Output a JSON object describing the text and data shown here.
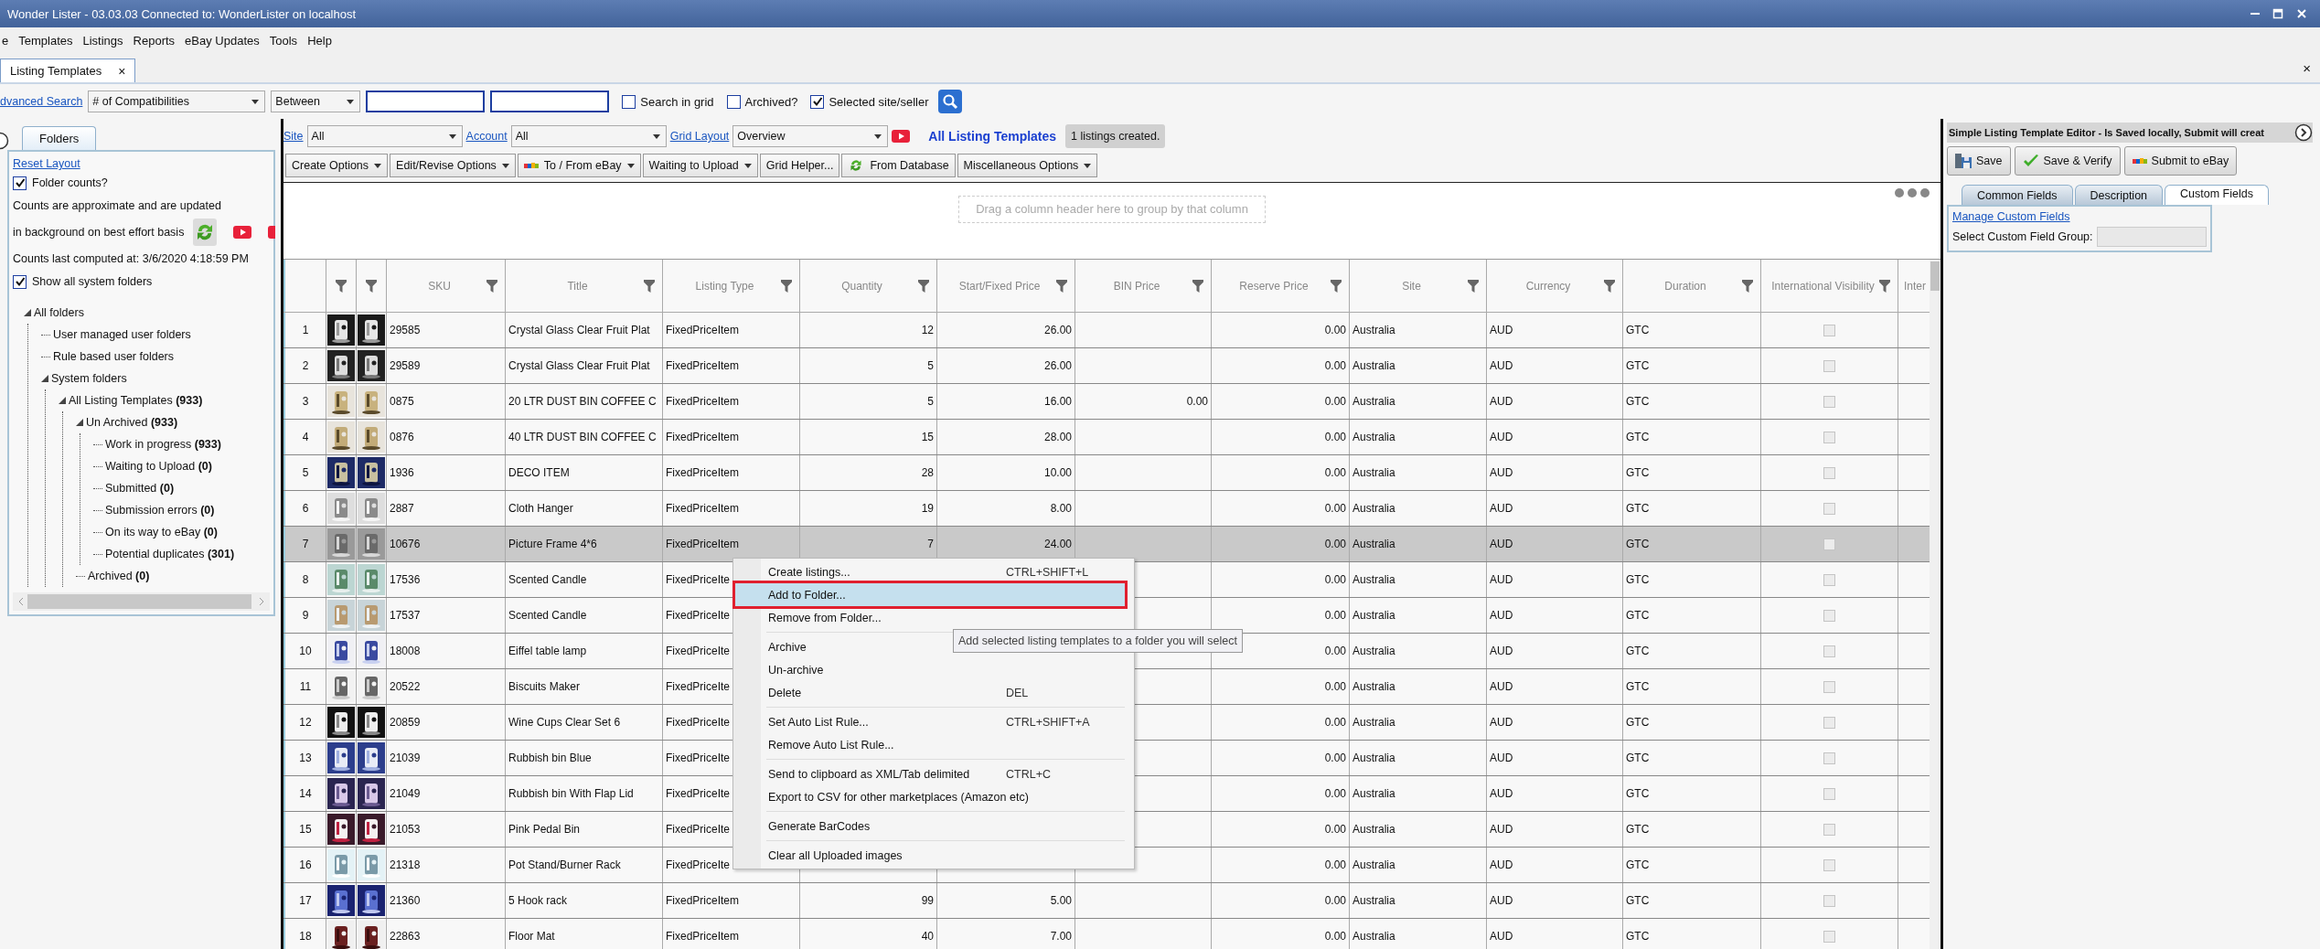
{
  "window": {
    "title": "Wonder Lister - 03.03.03 Connected to: WonderLister on localhost"
  },
  "menu": [
    "e",
    "Templates",
    "Listings",
    "Reports",
    "eBay Updates",
    "Tools",
    "Help"
  ],
  "doc_tabs": [
    {
      "label": "Listing Templates",
      "selected": true,
      "close": "×"
    }
  ],
  "strip_close": "×",
  "search_bar": {
    "link": "dvanced Search",
    "field": "# of Compatibilities",
    "operator": "Between",
    "options": [
      {
        "label": "Search in grid",
        "checked": false
      },
      {
        "label": "Archived?",
        "checked": false
      },
      {
        "label": "Selected site/seller",
        "checked": true
      }
    ]
  },
  "folders_panel": {
    "tab": "Folders",
    "reset_link": "Reset Layout",
    "folder_counts": {
      "label": "Folder counts?",
      "checked": true
    },
    "note_lines": [
      "Counts are approximate and are updated",
      "in background on best effort basis"
    ],
    "computed": "Counts last computed at: 3/6/2020 4:18:59 PM",
    "show_system": {
      "label": "Show all system folders",
      "checked": true
    },
    "tree": [
      {
        "label": "All folders",
        "expanded": true,
        "children": [
          {
            "label": "User managed user folders",
            "expanded": false
          },
          {
            "label": "Rule based user folders",
            "expanded": false
          },
          {
            "label": "System folders",
            "expanded": true,
            "children": [
              {
                "label": "All Listing Templates **(933)**",
                "expanded": true,
                "children": [
                  {
                    "label": "Un Archived **(933)**",
                    "expanded": true,
                    "children": [
                      {
                        "label": "Work in progress **(933)**",
                        "expanded": false
                      },
                      {
                        "label": "Waiting to Upload **(0)**",
                        "expanded": false
                      },
                      {
                        "label": "Submitted **(0)**",
                        "expanded": false
                      },
                      {
                        "label": "Submission errors **(0)**",
                        "expanded": false
                      },
                      {
                        "label": "On its way to eBay **(0)**",
                        "expanded": false
                      },
                      {
                        "label": "Potential duplicates **(301)**",
                        "expanded": false
                      }
                    ]
                  },
                  {
                    "label": "Archived **(0)**",
                    "expanded": false
                  }
                ]
              }
            ]
          }
        ]
      }
    ]
  },
  "grid_toolbar": {
    "site_label": "Site",
    "site": "All",
    "account_label": "Account",
    "account": "All",
    "layout_label": "Grid Layout",
    "layout": "Overview",
    "heading": "All Listing Templates",
    "status": "1 listings created."
  },
  "actions": [
    {
      "label": "Create Options",
      "kind": "menu"
    },
    {
      "label": "Edit/Revise Options",
      "kind": "menu"
    },
    {
      "label": "To / From eBay",
      "kind": "logo-menu"
    },
    {
      "label": "Waiting to Upload",
      "kind": "menu"
    },
    {
      "label": "Grid Helper...",
      "kind": "button"
    },
    {
      "label": "From Database",
      "kind": "arrows-button"
    },
    {
      "label": "Miscellaneous Options",
      "kind": "menu"
    }
  ],
  "group_hint": "Drag a column header here to group by that column",
  "table": {
    "columns": [
      {
        "label": "SKU",
        "kind": "text"
      },
      {
        "label": "Title",
        "kind": "text"
      },
      {
        "label": "Listing Type",
        "kind": "text"
      },
      {
        "label": "Quantity",
        "kind": "number"
      },
      {
        "label": "Start/Fixed Price",
        "kind": "number"
      },
      {
        "label": "BIN Price",
        "kind": "number"
      },
      {
        "label": "Reserve Price",
        "kind": "number"
      },
      {
        "label": "Site",
        "kind": "text"
      },
      {
        "label": "Currency",
        "kind": "text"
      },
      {
        "label": "Duration",
        "kind": "text"
      },
      {
        "label": "International Visibility",
        "kind": "check"
      },
      {
        "label": "Inter",
        "kind": "text"
      }
    ],
    "rows": [
      {
        "number": "1",
        "selected": false,
        "cells": [
          "29585",
          "Crystal Glass Clear Fruit Plat",
          "FixedPriceItem",
          "12",
          "26.00",
          null,
          "0.00",
          "Australia",
          "AUD",
          "GTC",
          false
        ]
      },
      {
        "number": "2",
        "selected": false,
        "cells": [
          "29589",
          "Crystal Glass Clear Fruit Plat",
          "FixedPriceItem",
          "5",
          "26.00",
          null,
          "0.00",
          "Australia",
          "AUD",
          "GTC",
          false
        ]
      },
      {
        "number": "3",
        "selected": false,
        "cells": [
          "0875",
          "20 LTR DUST BIN COFFEE C",
          "FixedPriceItem",
          "5",
          "16.00",
          "0.00",
          "0.00",
          "Australia",
          "AUD",
          "GTC",
          false
        ]
      },
      {
        "number": "4",
        "selected": false,
        "cells": [
          "0876",
          "40 LTR DUST BIN COFFEE C",
          "FixedPriceItem",
          "15",
          "28.00",
          null,
          "0.00",
          "Australia",
          "AUD",
          "GTC",
          false
        ]
      },
      {
        "number": "5",
        "selected": false,
        "cells": [
          "1936",
          "DECO ITEM",
          "FixedPriceItem",
          "28",
          "10.00",
          null,
          "0.00",
          "Australia",
          "AUD",
          "GTC",
          false
        ]
      },
      {
        "number": "6",
        "selected": false,
        "cells": [
          "2887",
          "Cloth Hanger",
          "FixedPriceItem",
          "19",
          "8.00",
          null,
          "0.00",
          "Australia",
          "AUD",
          "GTC",
          false
        ]
      },
      {
        "number": "7",
        "selected": true,
        "cells": [
          "10676",
          "Picture Frame 4*6",
          "FixedPriceItem",
          "7",
          "24.00",
          null,
          "0.00",
          "Australia",
          "AUD",
          "GTC",
          false
        ]
      },
      {
        "number": "8",
        "selected": false,
        "cells": [
          "17536",
          "Scented Candle",
          "FixedPriceIte",
          null,
          null,
          null,
          "0.00",
          "Australia",
          "AUD",
          "GTC",
          false
        ]
      },
      {
        "number": "9",
        "selected": false,
        "cells": [
          "17537",
          "Scented Candle",
          "FixedPriceIte",
          null,
          null,
          null,
          "0.00",
          "Australia",
          "AUD",
          "GTC",
          false
        ]
      },
      {
        "number": "10",
        "selected": false,
        "cells": [
          "18008",
          "Eiffel table lamp",
          "FixedPriceIte",
          null,
          null,
          null,
          "0.00",
          "Australia",
          "AUD",
          "GTC",
          false
        ]
      },
      {
        "number": "11",
        "selected": false,
        "cells": [
          "20522",
          "Biscuits Maker",
          "FixedPriceIte",
          null,
          null,
          null,
          "0.00",
          "Australia",
          "AUD",
          "GTC",
          false
        ]
      },
      {
        "number": "12",
        "selected": false,
        "cells": [
          "20859",
          "Wine Cups Clear Set 6",
          "FixedPriceIte",
          null,
          null,
          null,
          "0.00",
          "Australia",
          "AUD",
          "GTC",
          false
        ]
      },
      {
        "number": "13",
        "selected": false,
        "cells": [
          "21039",
          "Rubbish bin Blue",
          "FixedPriceIte",
          null,
          null,
          null,
          "0.00",
          "Australia",
          "AUD",
          "GTC",
          false
        ]
      },
      {
        "number": "14",
        "selected": false,
        "cells": [
          "21049",
          "Rubbish bin With Flap Lid",
          "FixedPriceIte",
          null,
          null,
          null,
          "0.00",
          "Australia",
          "AUD",
          "GTC",
          false
        ]
      },
      {
        "number": "15",
        "selected": false,
        "cells": [
          "21053",
          "Pink Pedal Bin",
          "FixedPriceIte",
          null,
          null,
          null,
          "0.00",
          "Australia",
          "AUD",
          "GTC",
          false
        ]
      },
      {
        "number": "16",
        "selected": false,
        "cells": [
          "21318",
          "Pot Stand/Burner Rack",
          "FixedPriceIte",
          null,
          null,
          null,
          "0.00",
          "Australia",
          "AUD",
          "GTC",
          false
        ]
      },
      {
        "number": "17",
        "selected": false,
        "cells": [
          "21360",
          "5 Hook rack",
          "FixedPriceItem",
          "99",
          "5.00",
          null,
          "0.00",
          "Australia",
          "AUD",
          "GTC",
          false
        ]
      },
      {
        "number": "18",
        "selected": false,
        "cells": [
          "22863",
          "Floor Mat",
          "FixedPriceItem",
          "40",
          "7.00",
          null,
          "0.00",
          "Australia",
          "AUD",
          "GTC",
          false
        ]
      }
    ]
  },
  "context_menu": {
    "groups": [
      [
        {
          "label": "Create listings...",
          "shortcut": "CTRL+SHIFT+L",
          "selected": false
        },
        {
          "label": "Add to Folder...",
          "selected": true
        },
        {
          "label": "Remove from Folder...",
          "selected": false
        }
      ],
      [
        {
          "label": "Archive",
          "selected": false
        },
        {
          "label": "Un-archive",
          "selected": false
        },
        {
          "label": "Delete",
          "shortcut": "DEL",
          "selected": false
        }
      ],
      [
        {
          "label": "Set Auto List Rule...",
          "shortcut": "CTRL+SHIFT+A",
          "selected": false
        },
        {
          "label": "Remove Auto List Rule...",
          "selected": false
        }
      ],
      [
        {
          "label": "Send to clipboard as XML/Tab delimited",
          "shortcut": "CTRL+C",
          "selected": false
        },
        {
          "label": "Export to CSV for other marketplaces (Amazon etc)",
          "selected": false
        }
      ],
      [
        {
          "label": "Generate BarCodes",
          "selected": false
        }
      ],
      [
        {
          "label": "Clear all Uploaded images",
          "selected": false
        }
      ]
    ]
  },
  "tooltip": "Add selected listing templates to a folder you will select",
  "editor": {
    "title": "Simple Listing Template Editor - Is Saved locally, Submit will creat",
    "buttons": [
      {
        "label": "Save",
        "kind": "save"
      },
      {
        "label": "Save & Verify",
        "kind": "verify"
      },
      {
        "label": "Submit to eBay",
        "kind": "logo"
      }
    ],
    "tabs": [
      {
        "label": "Common Fields",
        "selected": false
      },
      {
        "label": "Description",
        "selected": false
      },
      {
        "label": "Custom Fields",
        "selected": true
      }
    ],
    "manage_link": "Manage Custom Fields",
    "group_label": "Select Custom Field Group:"
  }
}
